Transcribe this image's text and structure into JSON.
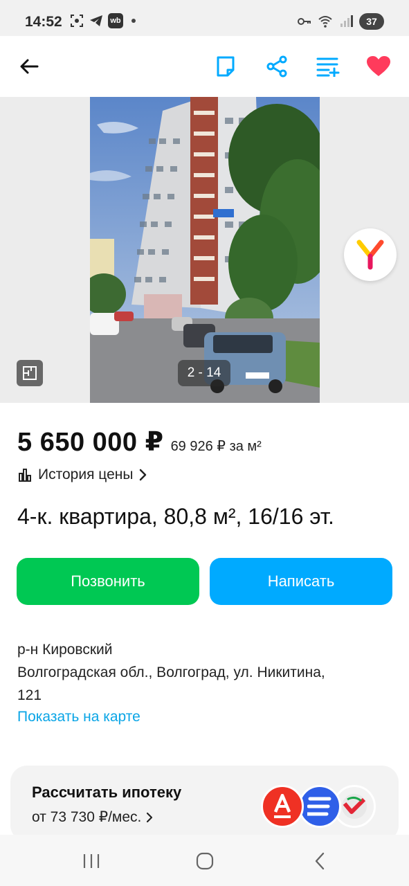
{
  "status_bar": {
    "time": "14:52",
    "wb_label": "wb",
    "battery": "37",
    "icons": [
      "screenshot-icon",
      "telegram-icon",
      "wb-icon",
      "key-icon",
      "wifi-icon",
      "signal-icon",
      "battery-icon"
    ]
  },
  "toolbar": {
    "icons": [
      "back-arrow-icon",
      "note-icon",
      "share-icon",
      "compare-icon",
      "heart-icon"
    ],
    "accent_color": "#00aaff",
    "favorite_color": "#ff3b5c"
  },
  "gallery": {
    "counter": "2 - 14",
    "icons": [
      "floor-plan-icon",
      "yandex-icon"
    ]
  },
  "listing": {
    "price": "5 650 000 ₽",
    "price_per_m": "69 926 ₽ за м²",
    "price_history_label": "История цены",
    "title": "4-к. квартира, 80,8 м², 16/16 эт.",
    "call_button": "Позвонить",
    "write_button": "Написать",
    "district": "р-н Кировский",
    "address_line1": "Волгоградская обл., Волгоград, ул. Никитина,",
    "address_line2": "121",
    "map_link": "Показать на карте"
  },
  "mortgage": {
    "title": "Рассчитать ипотеку",
    "subtitle": "от 73 730 ₽/мес.",
    "bank_logos": [
      "alfa-bank-icon",
      "bank-stripes-icon",
      "bank-check-icon"
    ]
  },
  "nav_bar": {
    "icons": [
      "recents-icon",
      "home-icon",
      "back-icon"
    ]
  }
}
